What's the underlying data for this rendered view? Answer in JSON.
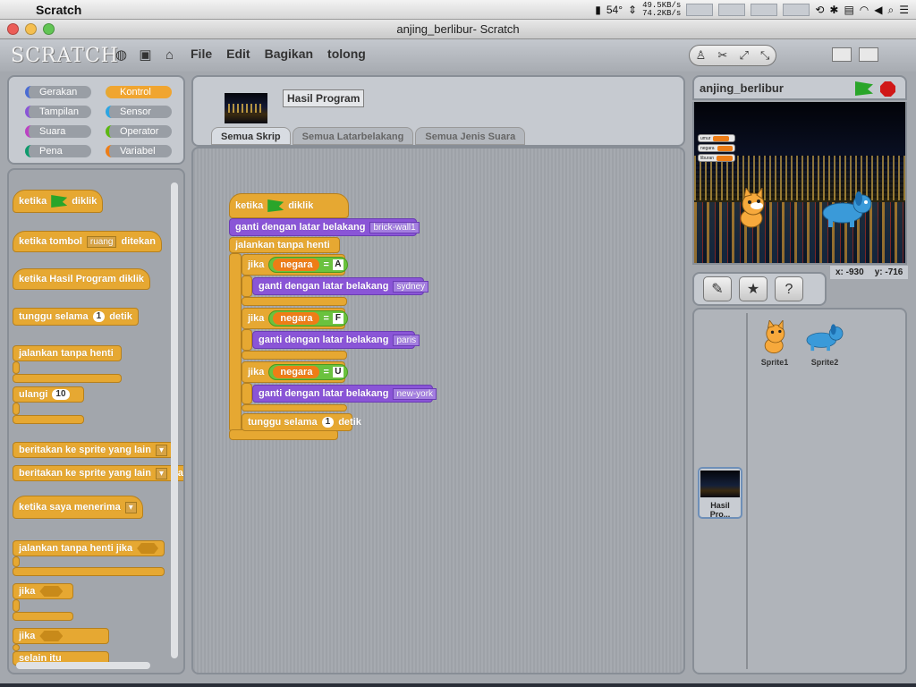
{
  "menubar": {
    "app_name": "Scratch",
    "temperature": "54°",
    "net_up": "49.5KB/s",
    "net_down": "74.2KB/s"
  },
  "window": {
    "title": "anjing_berlibur- Scratch"
  },
  "toolbar": {
    "logo": "SCRATCH",
    "menus": [
      "File",
      "Edit",
      "Bagikan",
      "tolong"
    ]
  },
  "categories": [
    {
      "label": "Gerakan",
      "color": "#4a6cd4"
    },
    {
      "label": "Kontrol",
      "color": "#e6a832"
    },
    {
      "label": "Tampilan",
      "color": "#8a55d7"
    },
    {
      "label": "Sensor",
      "color": "#2ca5e2"
    },
    {
      "label": "Suara",
      "color": "#bb42c3"
    },
    {
      "label": "Operator",
      "color": "#5cb712"
    },
    {
      "label": "Pena",
      "color": "#0e9a6c"
    },
    {
      "label": "Variabel",
      "color": "#ee7d16"
    }
  ],
  "palette": {
    "when_flag": "ketika",
    "when_flag_suffix": "diklik",
    "when_key": "ketika tombol",
    "when_key_value": "ruang",
    "when_key_suffix": "ditekan",
    "when_clicked": "ketika  Hasil Program  diklik",
    "wait": "tunggu selama",
    "wait_value": "1",
    "wait_suffix": "detik",
    "forever": "jalankan tanpa henti",
    "repeat": "ulangi",
    "repeat_value": "10",
    "broadcast": "beritakan ke sprite yang lain",
    "broadcast_wait": "beritakan ke sprite yang lain",
    "broadcast_wait_suffix": "dan",
    "when_receive": "ketika saya menerima",
    "forever_if": "jalankan tanpa henti jika",
    "if": "jika",
    "if_else": "jika",
    "else": "selain itu"
  },
  "center": {
    "program_name": "Hasil Program",
    "tabs": [
      "Semua Skrip",
      "Semua Latarbelakang",
      "Semua Jenis Suara"
    ]
  },
  "script": {
    "hat": "ketika",
    "hat_suffix": "diklik",
    "switch_bg": "ganti dengan latar belakang",
    "bg_first": "brick-wall1",
    "forever": "jalankan tanpa henti",
    "if_label": "jika",
    "var_name": "negara",
    "eq": "=",
    "cond1": "A",
    "bg1": "sydney",
    "cond2": "F",
    "bg2": "paris",
    "cond3": "U",
    "bg3": "new-york",
    "wait": "tunggu selama",
    "wait_value": "1",
    "wait_suffix": "detik"
  },
  "stage": {
    "sprite_name": "anjing_berlibur",
    "watchers": [
      "umur",
      "negara",
      "liburan"
    ],
    "x_label": "x: -930",
    "y_label": "y: -716"
  },
  "sprites": [
    {
      "name": "Sprite1"
    },
    {
      "name": "Sprite2"
    }
  ],
  "stage_item": {
    "label": "Hasil Pro..."
  }
}
